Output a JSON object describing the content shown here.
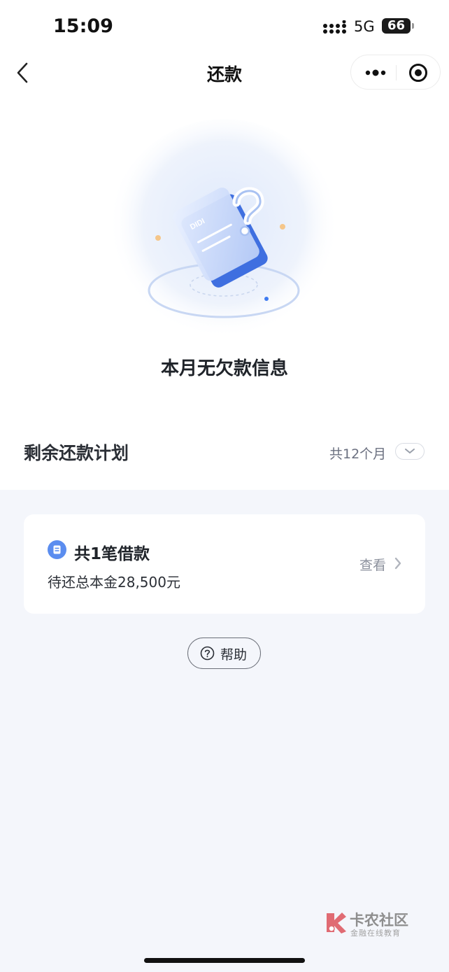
{
  "status_bar": {
    "time": "15:09",
    "network": "5G",
    "battery": "66"
  },
  "nav": {
    "title": "还款",
    "back_icon": "chevron-left-icon",
    "more_icon": "more-dots-icon",
    "target_icon": "target-icon"
  },
  "empty_state": {
    "title": "本月无欠款信息",
    "illustration_text": "DIDI"
  },
  "plan": {
    "title": "剩余还款计划",
    "count": "共12个月"
  },
  "loan_card": {
    "title": "共1笔借款",
    "subtitle": "待还总本金28,500元",
    "view_label": "查看"
  },
  "help": {
    "label": "帮助"
  },
  "watermark": {
    "title": "卡农社区",
    "subtitle": "金融在线教育"
  },
  "colors": {
    "accent_blue": "#3f7bf0",
    "page_bg": "#f4f6fb"
  }
}
